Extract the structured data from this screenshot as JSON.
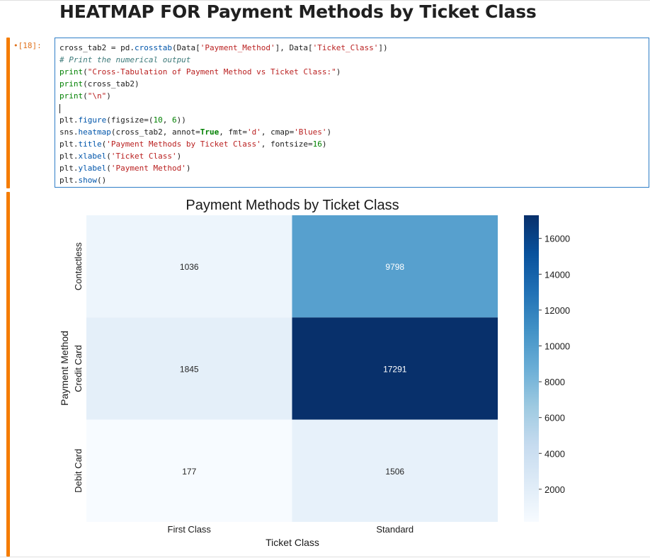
{
  "heading": "HEATMAP FOR Payment Methods by Ticket Class",
  "cell": {
    "prompt": "•[18]:",
    "code_lines": [
      [
        {
          "t": "cross_tab2 = pd.",
          "c": ""
        },
        {
          "t": "crosstab",
          "c": "attr"
        },
        {
          "t": "(Data[",
          "c": ""
        },
        {
          "t": "'Payment_Method'",
          "c": "str"
        },
        {
          "t": "], Data[",
          "c": ""
        },
        {
          "t": "'Ticket_Class'",
          "c": "str"
        },
        {
          "t": "])",
          "c": ""
        }
      ],
      [
        {
          "t": "# Print the numerical output",
          "c": "comment"
        }
      ],
      [
        {
          "t": "print",
          "c": "fn"
        },
        {
          "t": "(",
          "c": ""
        },
        {
          "t": "\"Cross-Tabulation of Payment Method vs Ticket Class:\"",
          "c": "str"
        },
        {
          "t": ")",
          "c": ""
        }
      ],
      [
        {
          "t": "print",
          "c": "fn"
        },
        {
          "t": "(cross_tab2)",
          "c": ""
        }
      ],
      [
        {
          "t": "print",
          "c": "fn"
        },
        {
          "t": "(",
          "c": ""
        },
        {
          "t": "\"\\n\"",
          "c": "str"
        },
        {
          "t": ")",
          "c": ""
        }
      ],
      [
        {
          "t": "",
          "c": "cursor"
        }
      ],
      [
        {
          "t": "plt.",
          "c": ""
        },
        {
          "t": "figure",
          "c": "attr"
        },
        {
          "t": "(figsize=(",
          "c": ""
        },
        {
          "t": "10",
          "c": "num"
        },
        {
          "t": ", ",
          "c": ""
        },
        {
          "t": "6",
          "c": "num"
        },
        {
          "t": "))",
          "c": ""
        }
      ],
      [
        {
          "t": "sns.",
          "c": ""
        },
        {
          "t": "heatmap",
          "c": "attr"
        },
        {
          "t": "(cross_tab2, annot=",
          "c": ""
        },
        {
          "t": "True",
          "c": "kw"
        },
        {
          "t": ", fmt=",
          "c": ""
        },
        {
          "t": "'d'",
          "c": "str"
        },
        {
          "t": ", cmap=",
          "c": ""
        },
        {
          "t": "'Blues'",
          "c": "str"
        },
        {
          "t": ")",
          "c": ""
        }
      ],
      [
        {
          "t": "plt.",
          "c": ""
        },
        {
          "t": "title",
          "c": "attr"
        },
        {
          "t": "(",
          "c": ""
        },
        {
          "t": "'Payment Methods by Ticket Class'",
          "c": "str"
        },
        {
          "t": ", fontsize=",
          "c": ""
        },
        {
          "t": "16",
          "c": "num"
        },
        {
          "t": ")",
          "c": ""
        }
      ],
      [
        {
          "t": "plt.",
          "c": ""
        },
        {
          "t": "xlabel",
          "c": "attr"
        },
        {
          "t": "(",
          "c": ""
        },
        {
          "t": "'Ticket Class'",
          "c": "str"
        },
        {
          "t": ")",
          "c": ""
        }
      ],
      [
        {
          "t": "plt.",
          "c": ""
        },
        {
          "t": "ylabel",
          "c": "attr"
        },
        {
          "t": "(",
          "c": ""
        },
        {
          "t": "'Payment Method'",
          "c": "str"
        },
        {
          "t": ")",
          "c": ""
        }
      ],
      [
        {
          "t": "plt.",
          "c": ""
        },
        {
          "t": "show",
          "c": "attr"
        },
        {
          "t": "()",
          "c": ""
        }
      ]
    ]
  },
  "colors": {
    "accent": "#f57c00",
    "editor_border": "#2f7ec7",
    "cmap_low": "#f7fbff",
    "cmap_high": "#08306b"
  },
  "chart_data": {
    "type": "heatmap",
    "title": "Payment Methods by Ticket Class",
    "xlabel": "Ticket Class",
    "ylabel": "Payment Method",
    "x_categories": [
      "First Class",
      "Standard"
    ],
    "y_categories": [
      "Contactless",
      "Credit Card",
      "Debit Card"
    ],
    "values": [
      [
        1036,
        9798
      ],
      [
        1845,
        17291
      ],
      [
        177,
        1506
      ]
    ],
    "colorbar": {
      "min": 177,
      "max": 17291,
      "ticks": [
        2000,
        4000,
        6000,
        8000,
        10000,
        12000,
        14000,
        16000
      ]
    },
    "colormap": "Blues"
  }
}
